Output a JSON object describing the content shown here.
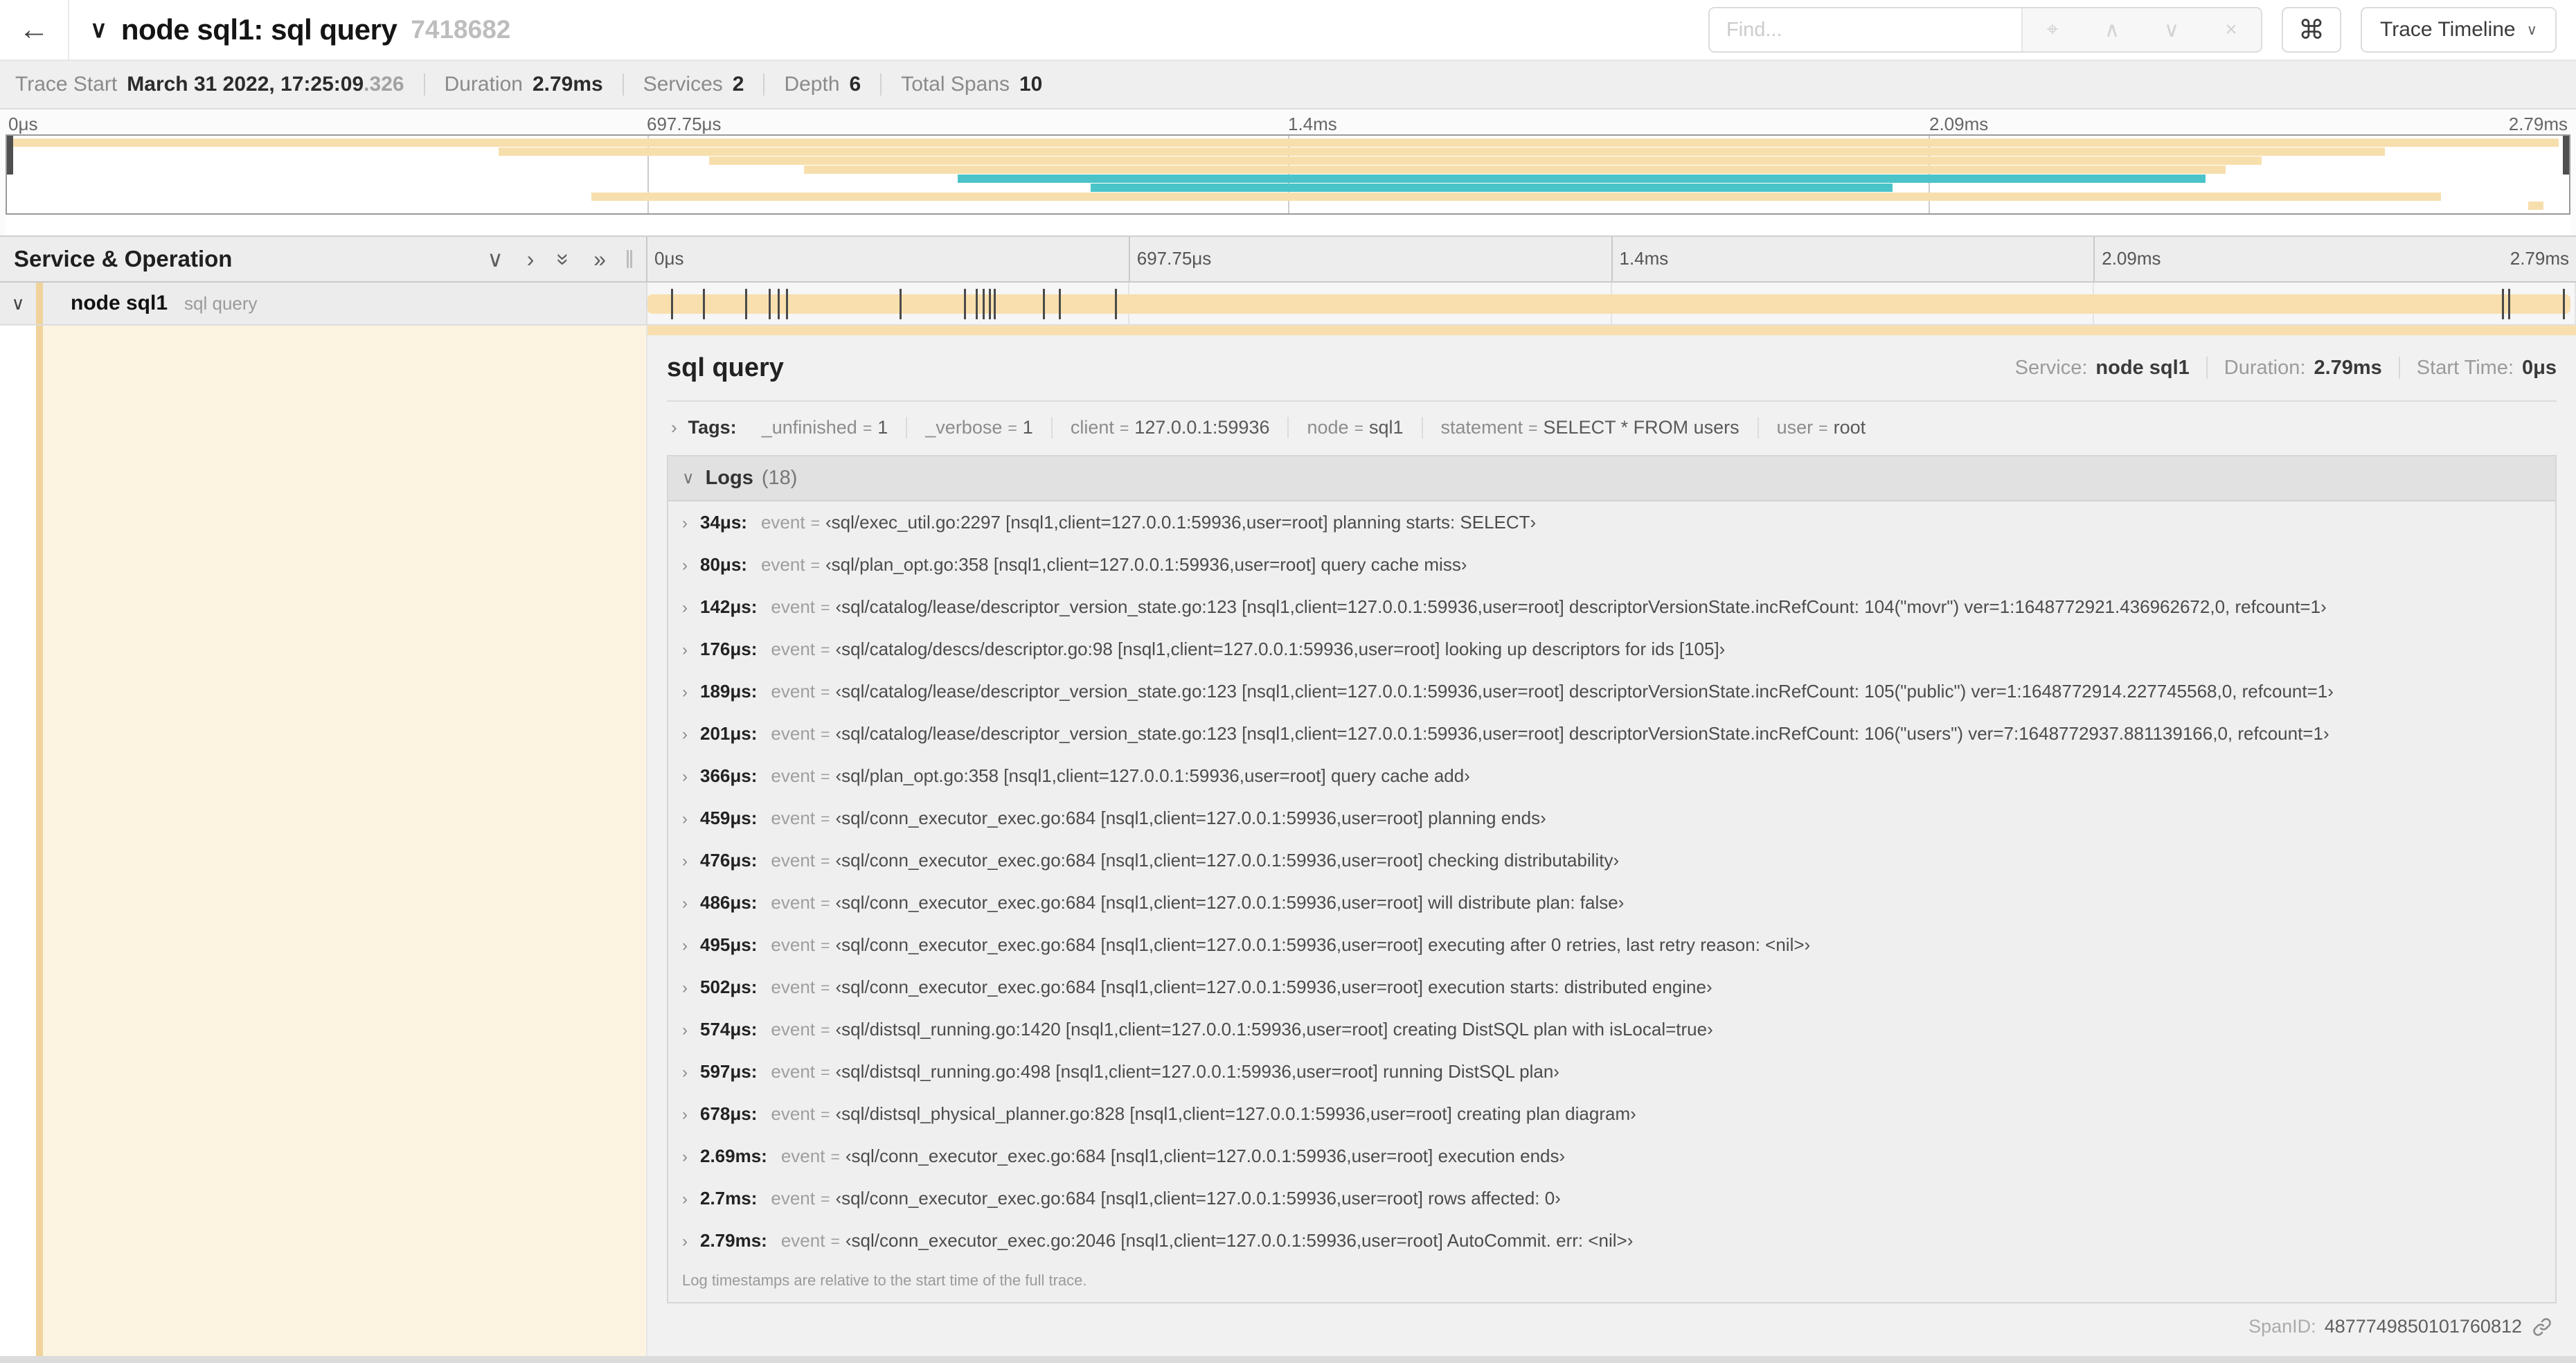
{
  "header": {
    "back_label": "←",
    "title": "node sql1: sql query",
    "trace_id": "7418682",
    "find_placeholder": "Find...",
    "trace_timeline_label": "Trace Timeline"
  },
  "meta": {
    "trace_start_label": "Trace Start",
    "trace_start_value": "March 31 2022, 17:25:09",
    "trace_start_ms": ".326",
    "duration_label": "Duration",
    "duration_value": "2.79ms",
    "services_label": "Services",
    "services_value": "2",
    "depth_label": "Depth",
    "depth_value": "6",
    "total_spans_label": "Total Spans",
    "total_spans_value": "10"
  },
  "colors": {
    "span_tan": "#F8DFAD",
    "span_teal": "#4AC4C8",
    "stripe_tan": "#EFD39B",
    "detail_cream": "#FCF3E0"
  },
  "minimap": {
    "bars": [
      {
        "row": 0,
        "color": "tan",
        "start_pct": 0.0,
        "end_pct": 99.6
      },
      {
        "row": 1,
        "color": "tan",
        "start_pct": 19.2,
        "end_pct": 92.8
      },
      {
        "row": 2,
        "color": "tan",
        "start_pct": 27.4,
        "end_pct": 88.0
      },
      {
        "row": 3,
        "color": "tan",
        "start_pct": 31.1,
        "end_pct": 86.6
      },
      {
        "row": 4,
        "color": "teal",
        "start_pct": 37.1,
        "end_pct": 85.8
      },
      {
        "row": 5,
        "color": "teal",
        "start_pct": 42.3,
        "end_pct": 73.6
      },
      {
        "row": 6,
        "color": "tan",
        "start_pct": 22.8,
        "end_pct": 95.0
      },
      {
        "row": 7,
        "color": "tan",
        "start_pct": 98.4,
        "end_pct": 99.0
      }
    ]
  },
  "timeline": {
    "ruler_labels": [
      "0μs",
      "697.75μs",
      "1.4ms",
      "2.09ms",
      "2.79ms"
    ],
    "svc_header": "Service & Operation",
    "span_row": {
      "service": "node sql1",
      "operation": "sql query",
      "log_tick_pct": [
        1.22,
        2.87,
        5.09,
        6.31,
        6.77,
        7.2,
        13.12,
        16.45,
        17.06,
        17.42,
        17.74,
        17.99,
        20.57,
        21.4,
        24.3,
        96.42,
        96.77,
        99.6
      ]
    }
  },
  "detail": {
    "title": "sql query",
    "overview": {
      "service_label": "Service:",
      "service_value": "node sql1",
      "duration_label": "Duration:",
      "duration_value": "2.79ms",
      "start_label": "Start Time:",
      "start_value": "0μs"
    },
    "tags_label": "Tags:",
    "tags": [
      {
        "key": "_unfinished",
        "value": "1"
      },
      {
        "key": "_verbose",
        "value": "1"
      },
      {
        "key": "client",
        "value": "127.0.0.1:59936"
      },
      {
        "key": "node",
        "value": "sql1"
      },
      {
        "key": "statement",
        "value": "SELECT * FROM users"
      },
      {
        "key": "user",
        "value": "root"
      }
    ],
    "logs": {
      "title": "Logs",
      "count": "(18)",
      "entries": [
        {
          "t": "34μs:",
          "key": "event",
          "value": "‹sql/exec_util.go:2297 [nsql1,client=127.0.0.1:59936,user=root] planning starts: SELECT›"
        },
        {
          "t": "80μs:",
          "key": "event",
          "value": "‹sql/plan_opt.go:358 [nsql1,client=127.0.0.1:59936,user=root] query cache miss›"
        },
        {
          "t": "142μs:",
          "key": "event",
          "value": "‹sql/catalog/lease/descriptor_version_state.go:123 [nsql1,client=127.0.0.1:59936,user=root] descriptorVersionState.incRefCount: 104(\"movr\") ver=1:1648772921.436962672,0, refcount=1›"
        },
        {
          "t": "176μs:",
          "key": "event",
          "value": "‹sql/catalog/descs/descriptor.go:98 [nsql1,client=127.0.0.1:59936,user=root] looking up descriptors for ids [105]›"
        },
        {
          "t": "189μs:",
          "key": "event",
          "value": "‹sql/catalog/lease/descriptor_version_state.go:123 [nsql1,client=127.0.0.1:59936,user=root] descriptorVersionState.incRefCount: 105(\"public\") ver=1:1648772914.227745568,0, refcount=1›"
        },
        {
          "t": "201μs:",
          "key": "event",
          "value": "‹sql/catalog/lease/descriptor_version_state.go:123 [nsql1,client=127.0.0.1:59936,user=root] descriptorVersionState.incRefCount: 106(\"users\") ver=7:1648772937.881139166,0, refcount=1›"
        },
        {
          "t": "366μs:",
          "key": "event",
          "value": "‹sql/plan_opt.go:358 [nsql1,client=127.0.0.1:59936,user=root] query cache add›"
        },
        {
          "t": "459μs:",
          "key": "event",
          "value": "‹sql/conn_executor_exec.go:684 [nsql1,client=127.0.0.1:59936,user=root] planning ends›"
        },
        {
          "t": "476μs:",
          "key": "event",
          "value": "‹sql/conn_executor_exec.go:684 [nsql1,client=127.0.0.1:59936,user=root] checking distributability›"
        },
        {
          "t": "486μs:",
          "key": "event",
          "value": "‹sql/conn_executor_exec.go:684 [nsql1,client=127.0.0.1:59936,user=root] will distribute plan: false›"
        },
        {
          "t": "495μs:",
          "key": "event",
          "value": "‹sql/conn_executor_exec.go:684 [nsql1,client=127.0.0.1:59936,user=root] executing after 0 retries, last retry reason: <nil>›"
        },
        {
          "t": "502μs:",
          "key": "event",
          "value": "‹sql/conn_executor_exec.go:684 [nsql1,client=127.0.0.1:59936,user=root] execution starts: distributed engine›"
        },
        {
          "t": "574μs:",
          "key": "event",
          "value": "‹sql/distsql_running.go:1420 [nsql1,client=127.0.0.1:59936,user=root] creating DistSQL plan with isLocal=true›"
        },
        {
          "t": "597μs:",
          "key": "event",
          "value": "‹sql/distsql_running.go:498 [nsql1,client=127.0.0.1:59936,user=root] running DistSQL plan›"
        },
        {
          "t": "678μs:",
          "key": "event",
          "value": "‹sql/distsql_physical_planner.go:828 [nsql1,client=127.0.0.1:59936,user=root] creating plan diagram›"
        },
        {
          "t": "2.69ms:",
          "key": "event",
          "value": "‹sql/conn_executor_exec.go:684 [nsql1,client=127.0.0.1:59936,user=root] execution ends›"
        },
        {
          "t": "2.7ms:",
          "key": "event",
          "value": "‹sql/conn_executor_exec.go:684 [nsql1,client=127.0.0.1:59936,user=root] rows affected: 0›"
        },
        {
          "t": "2.79ms:",
          "key": "event",
          "value": "‹sql/conn_executor_exec.go:2046 [nsql1,client=127.0.0.1:59936,user=root] AutoCommit. err: <nil>›"
        }
      ],
      "note": "Log timestamps are relative to the start time of the full trace."
    },
    "span_id_label": "SpanID:",
    "span_id_value": "4877749850101760812"
  }
}
